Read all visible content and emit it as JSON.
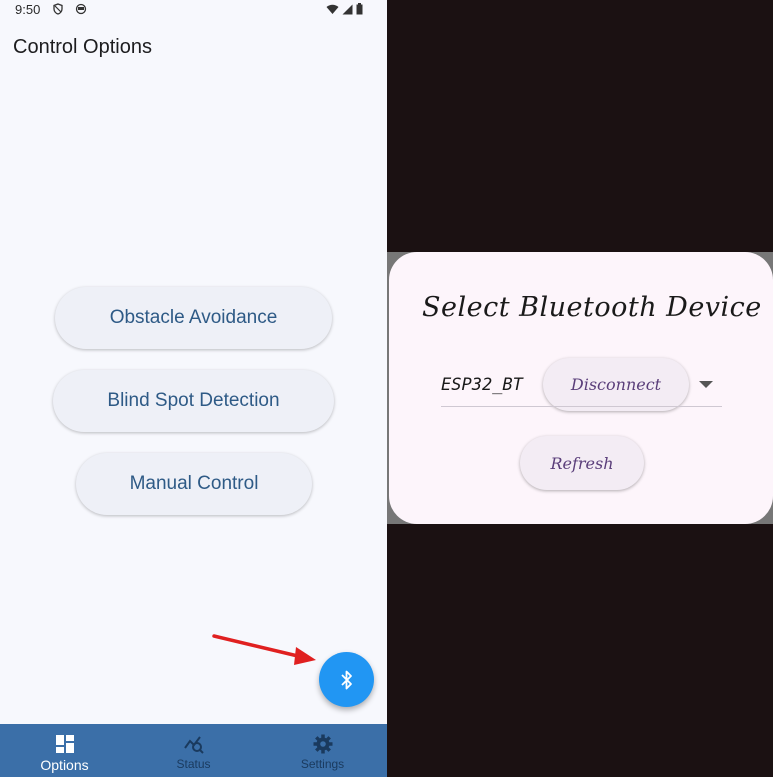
{
  "status_bar": {
    "time": "9:50"
  },
  "options_screen": {
    "title": "Control Options",
    "buttons": {
      "obstacle": "Obstacle Avoidance",
      "blind_spot": "Blind Spot Detection",
      "manual": "Manual Control"
    },
    "fab_icon": "bluetooth-icon"
  },
  "bottom_nav": {
    "items": [
      {
        "label": "Options",
        "icon": "dashboard-icon",
        "active": true
      },
      {
        "label": "Status",
        "icon": "query-stats-icon",
        "active": false
      },
      {
        "label": "Settings",
        "icon": "gear-icon",
        "active": false
      }
    ]
  },
  "bluetooth_dialog": {
    "title": "Select Bluetooth Device",
    "selected_device": "ESP32_BT",
    "disconnect_label": "Disconnect",
    "refresh_label": "Refresh"
  },
  "colors": {
    "accent": "#2196f3",
    "nav_bar": "#3b6fa8",
    "button_text": "#2e5a86",
    "annotation_arrow": "#e02020"
  }
}
